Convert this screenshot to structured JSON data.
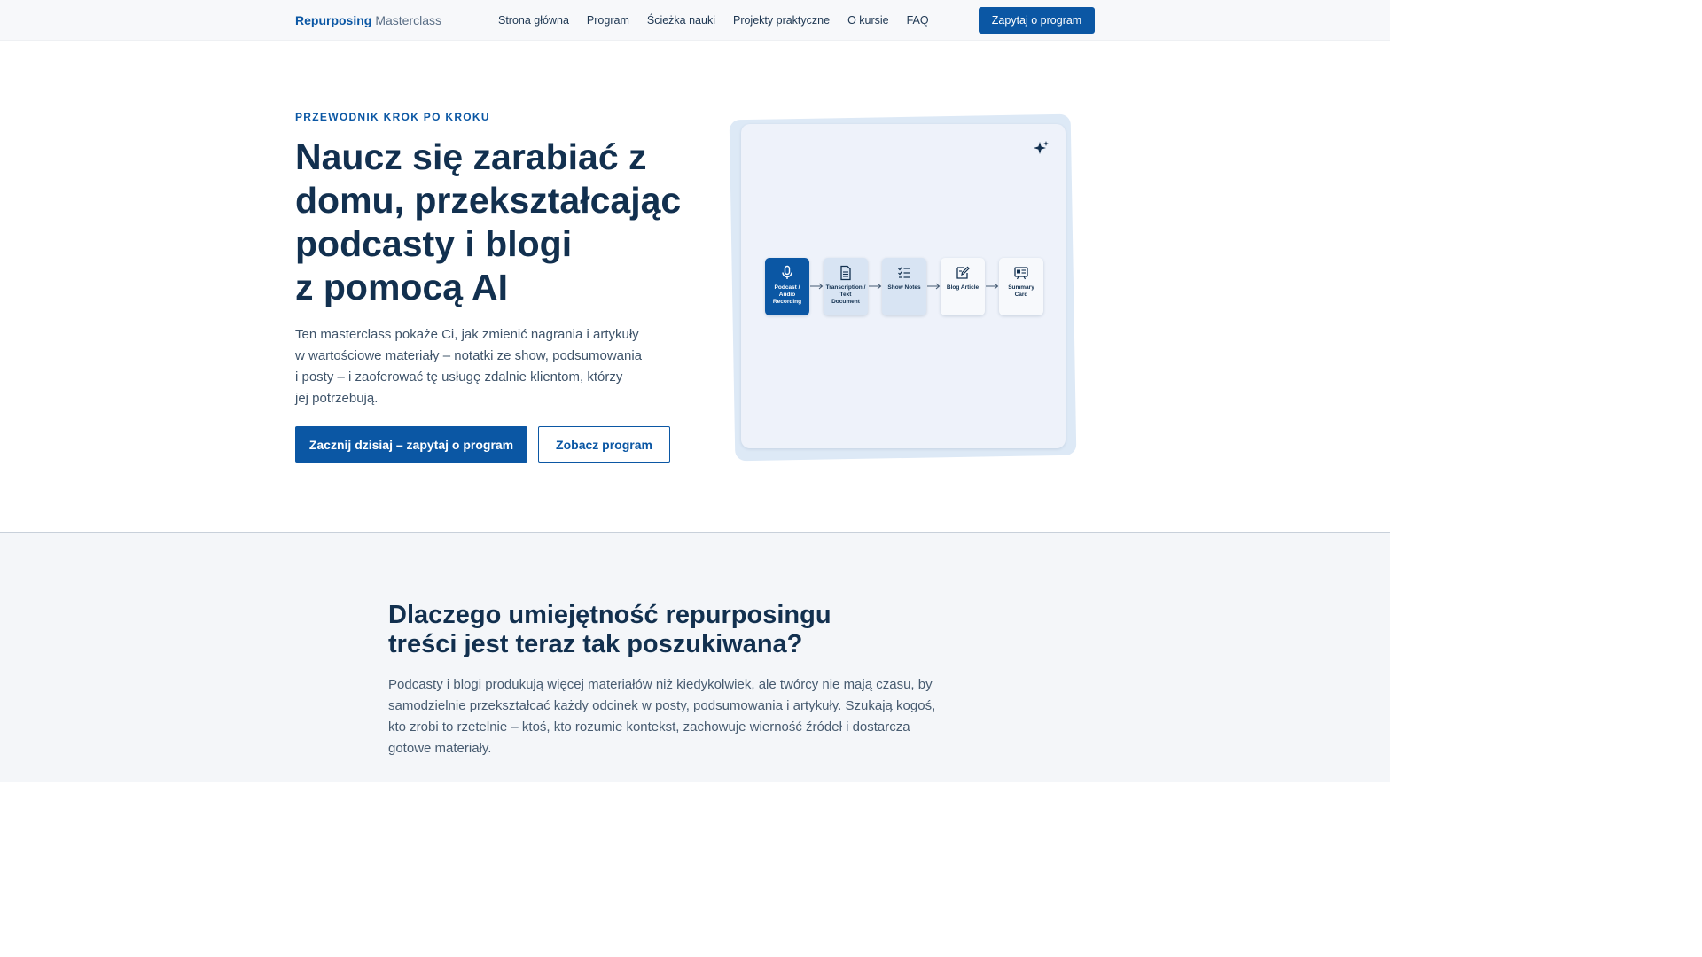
{
  "nav": {
    "brand_strong": "Repurposing",
    "brand_light": "Masterclass",
    "links": [
      "Strona główna",
      "Program",
      "Ścieżka nauki",
      "Projekty praktyczne",
      "O kursie",
      "FAQ"
    ],
    "cta": "Zapytaj o program"
  },
  "hero": {
    "eyebrow": "PRZEWODNIK KROK PO KROKU",
    "title_lines": [
      "Naucz się zarabiać z",
      "domu, przekształcając",
      "podcasty i blogi",
      "z pomocą AI"
    ],
    "desc_lines": [
      "Ten masterclass pokaże Ci, jak zmienić nagrania i artykuły",
      "w wartościowe materiały – notatki ze show, podsumowania",
      "i posty – i zaoferować tę usługę zdalnie klientom, którzy",
      "jej potrzebują."
    ],
    "primary_button": "Zacznij dzisiaj – zapytaj o program",
    "secondary_button": "Zobacz program"
  },
  "illustration": {
    "icon": "sparkle-icon",
    "steps": [
      {
        "label": "Podcast / Audio Recording",
        "icon": "microphone-icon"
      },
      {
        "label": "Transcription / Text Document",
        "icon": "document-icon"
      },
      {
        "label": "Show Notes",
        "icon": "checklist-icon"
      },
      {
        "label": "Blog Article",
        "icon": "edit-icon"
      },
      {
        "label": "Summary Card",
        "icon": "card-icon"
      }
    ]
  },
  "why": {
    "title_lines": [
      "Dlaczego umiejętność repurposingu",
      "treści jest teraz tak poszukiwana?"
    ],
    "desc_lines": [
      "Podcasty i blogi produkują więcej materiałów niż kiedykolwiek, ale twórcy nie mają czasu, by",
      "samodzielnie przekształcać każdy odcinek w posty, podsumowania i artykuły. Szukają kogoś,",
      "kto zrobi to rzetelnie – ktoś, kto rozumie kontekst, zachowuje wierność źródeł i dostarcza",
      "gotowe materiały."
    ]
  },
  "colors": {
    "accent": "#0b57a4",
    "heading": "#12304f",
    "body_text": "#3f546a",
    "section_bg": "#f4f6f9"
  }
}
